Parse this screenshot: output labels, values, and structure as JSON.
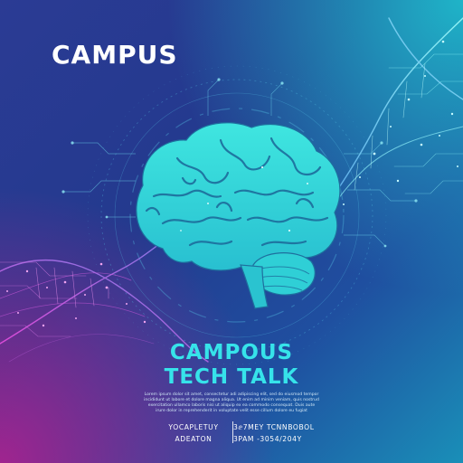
{
  "poster": {
    "brand": "CAMPUS",
    "headline_line1": "CAMPOUS",
    "headline_line2": "TECH TALK",
    "blurb_line1": "Lorem ipsum dolor sit amet, consectetur adi adipiscing elit, sed do eiusmod tempor",
    "blurb_line2": "incididunt ut labore et dolore magna aliqua. Ut enim ad minim veniam, quis nostrud",
    "blurb_line3": "exercitation ullamco laboris nisi ut aliquip ex ea commodo consequat. Duis aute",
    "blurb_line4": "irure dolor in reprehenderit in voluptate velit esse cillum dolore eu fugiat",
    "info_left_line1": "YOCAPLETUY",
    "info_left_line2": "ADEATON",
    "info_right_line1": "3ⅇ7MEY TCNNBOBOL",
    "info_right_line2": "3PAM -3054/204Y"
  },
  "colors": {
    "accent": "#36e3ea",
    "brain": "#2fd3d6",
    "background_deep": "#233a8e",
    "glow_magenta": "#a0248f"
  }
}
